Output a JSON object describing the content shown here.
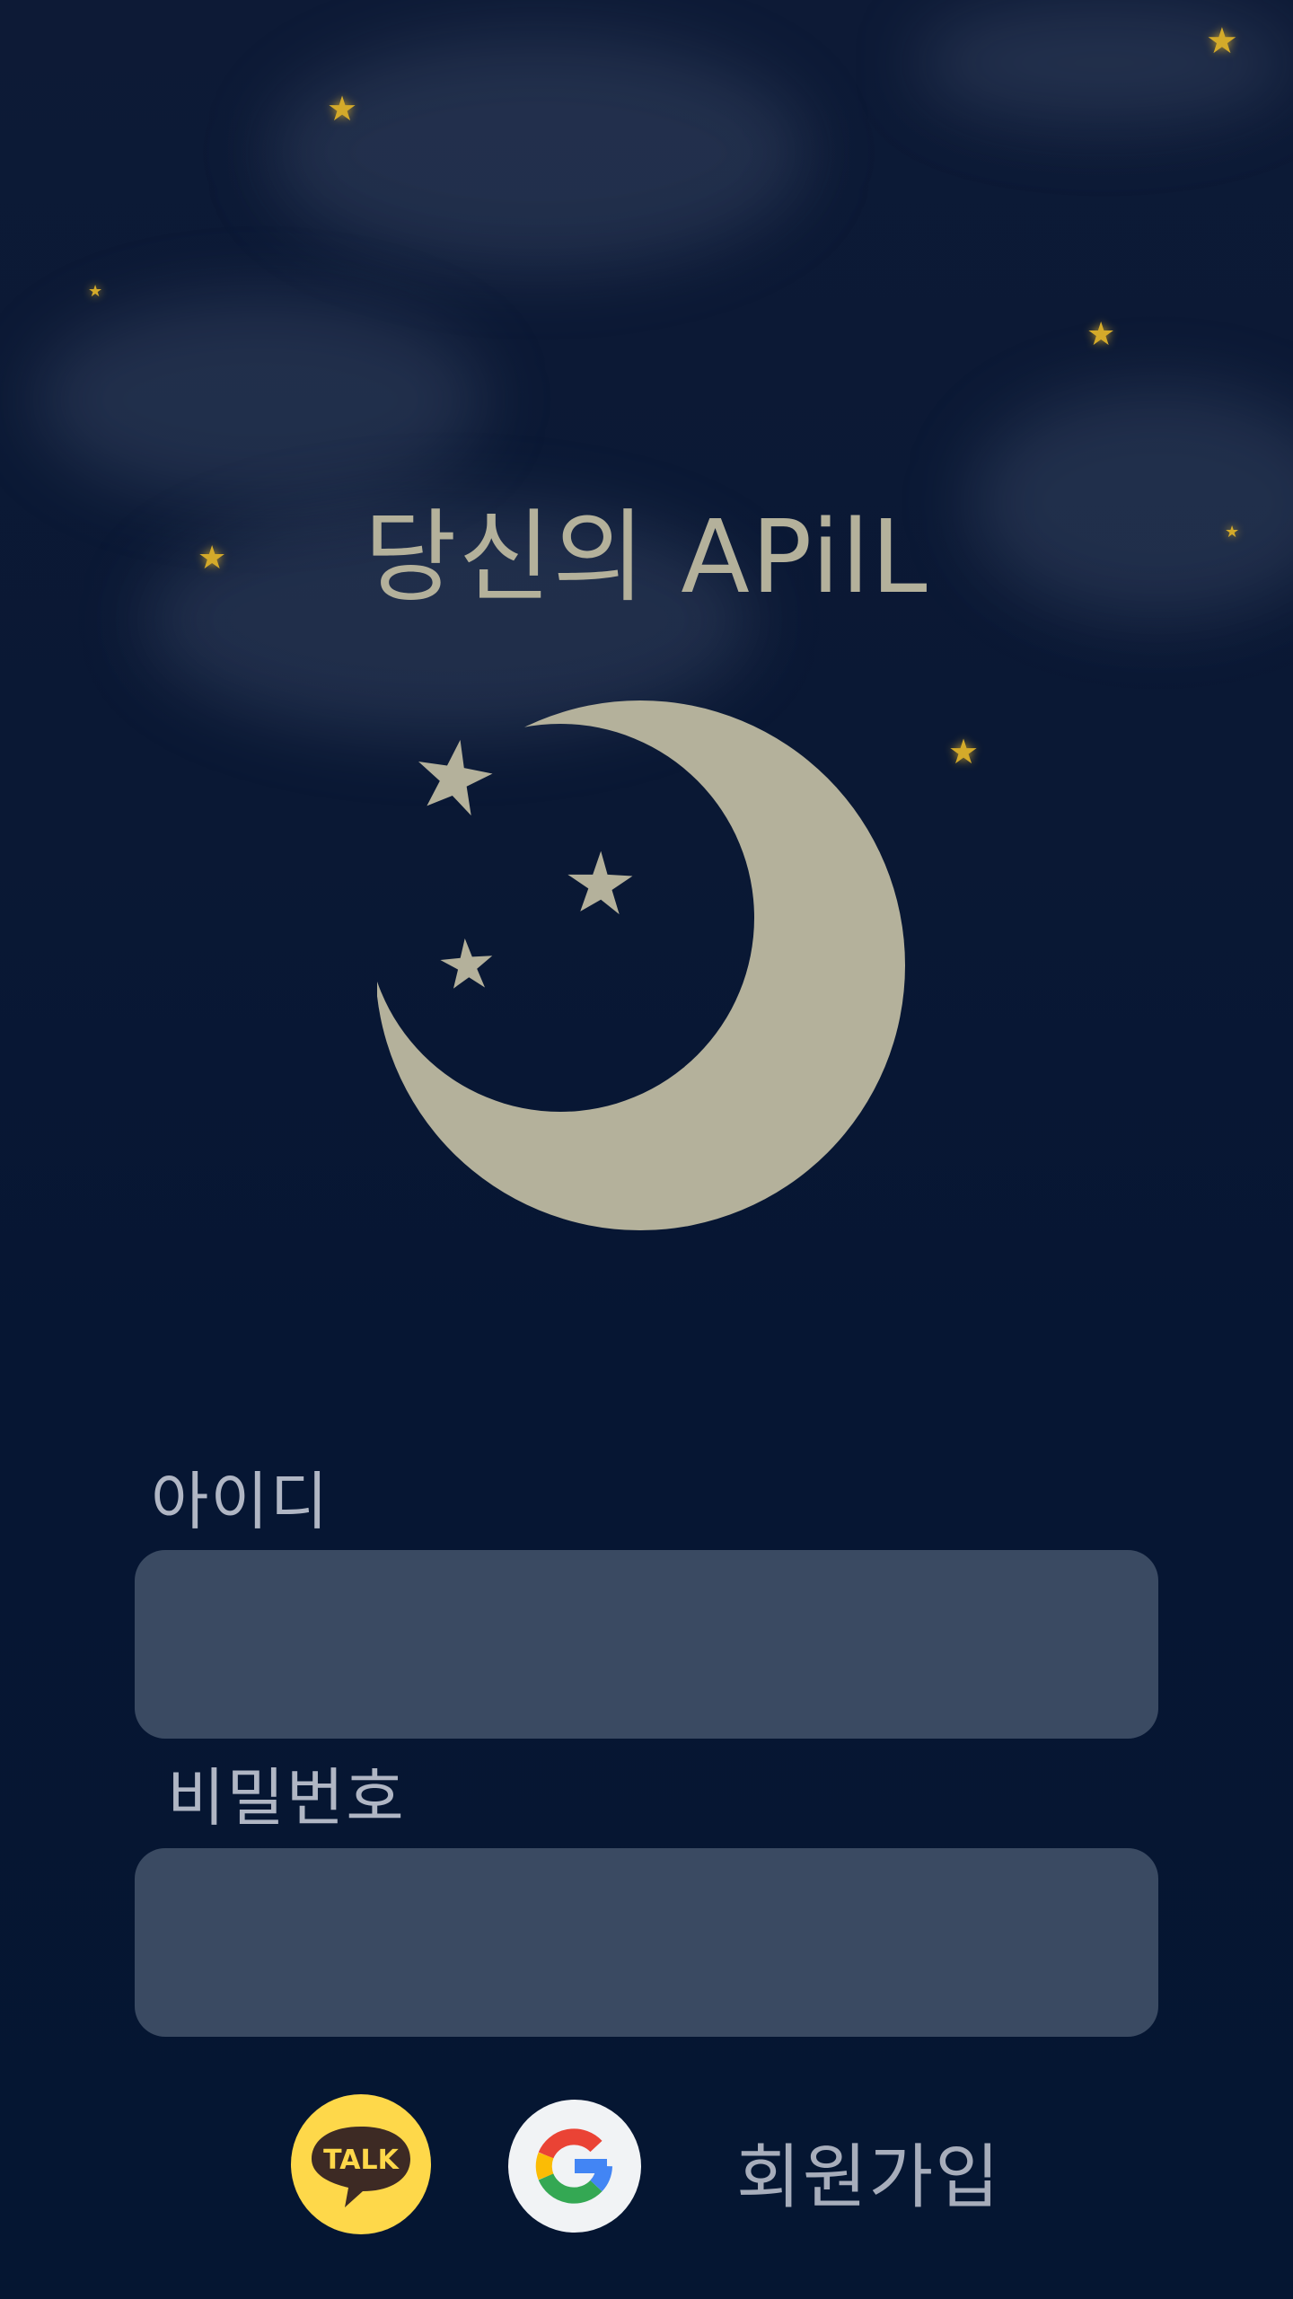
{
  "app": {
    "title": "당신의 APilL"
  },
  "login_form": {
    "id_label": "아이디",
    "id_value": "",
    "password_label": "비밀번호",
    "password_value": ""
  },
  "social_login": {
    "kakao": {
      "icon": "kakaotalk-icon",
      "text": "TALK",
      "color": "#fed84a"
    },
    "google": {
      "icon": "google-icon"
    }
  },
  "signup_label": "회원가입",
  "colors": {
    "background": "#061633",
    "moon": "#b4b19b",
    "input_background": "#3a4a62",
    "background_star": "#d4aa2a"
  }
}
